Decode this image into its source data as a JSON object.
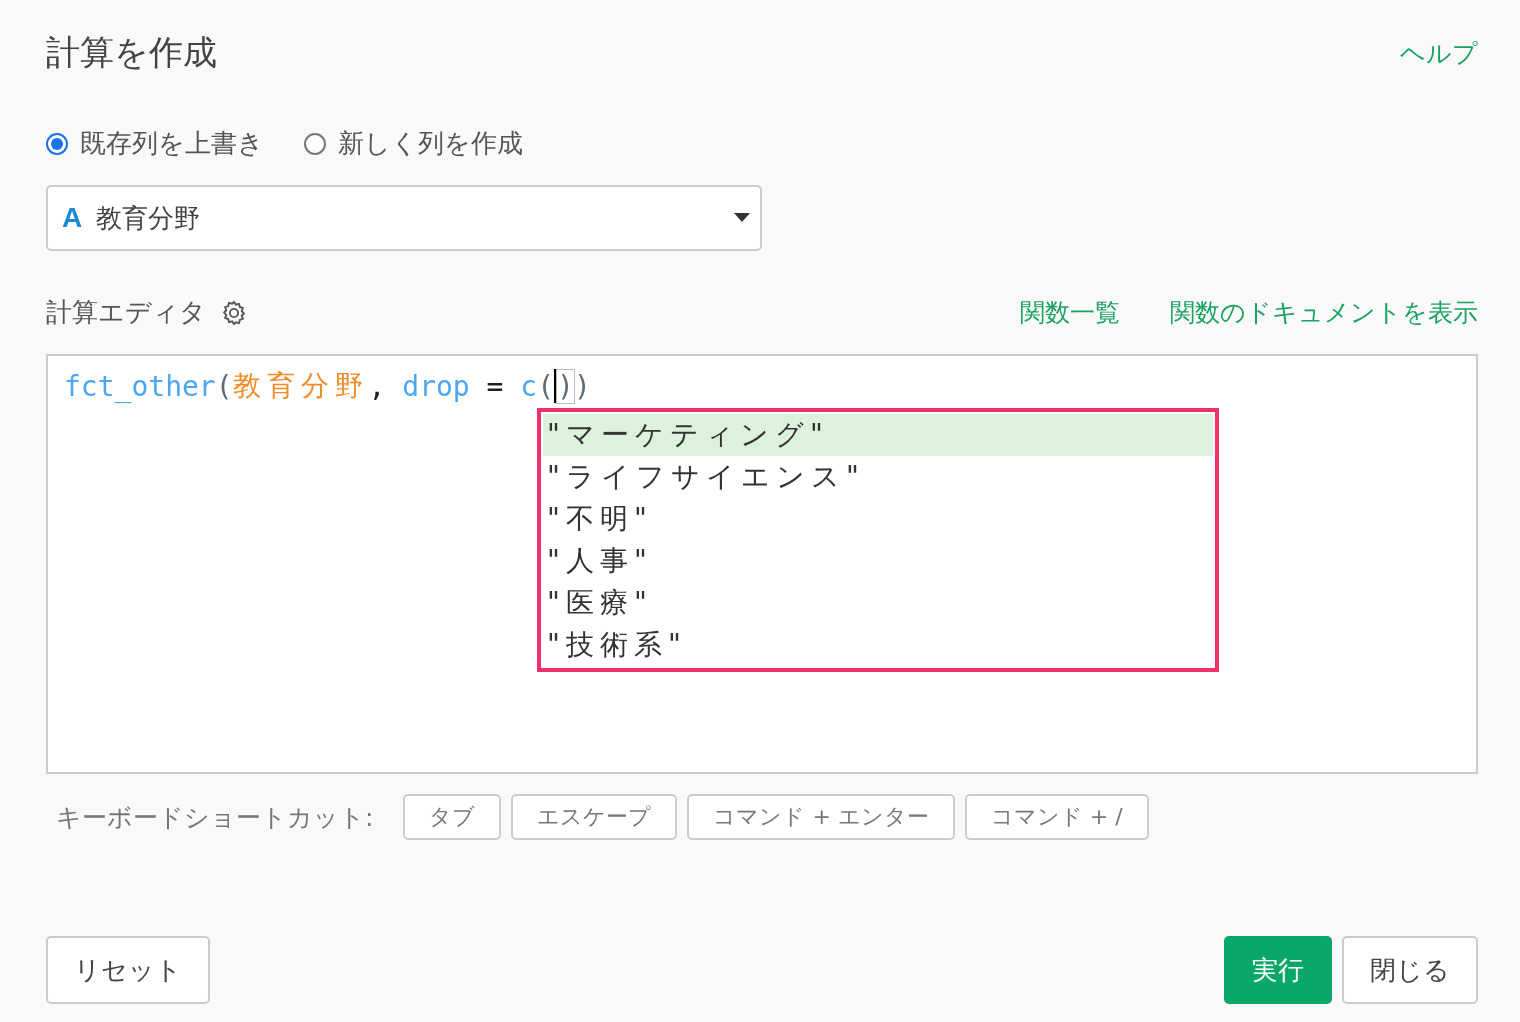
{
  "title": "計算を作成",
  "help_link": "ヘルプ",
  "mode_options": [
    {
      "label": "既存列を上書き",
      "selected": true
    },
    {
      "label": "新しく列を作成",
      "selected": false
    }
  ],
  "column_select": {
    "type_glyph": "A",
    "value": "教育分野"
  },
  "editor": {
    "label": "計算エディタ",
    "links": [
      "関数一覧",
      "関数のドキュメントを表示"
    ],
    "code": [
      {
        "kind": "name",
        "text": "fct_other"
      },
      {
        "kind": "paren",
        "text": "("
      },
      {
        "kind": "column",
        "text": "教育分野"
      },
      {
        "kind": "punct",
        "text": ", "
      },
      {
        "kind": "name",
        "text": "drop"
      },
      {
        "kind": "punct",
        "text": " = "
      },
      {
        "kind": "name",
        "text": "c"
      },
      {
        "kind": "paren",
        "text": "("
      },
      {
        "kind": "cursor"
      },
      {
        "kind": "match",
        "text": ")"
      },
      {
        "kind": "paren",
        "text": ")"
      }
    ],
    "suggestions": [
      {
        "text": "\"マーケティング\"",
        "selected": true
      },
      {
        "text": "\"ライフサイエンス\"",
        "selected": false
      },
      {
        "text": "\"不明\"",
        "selected": false
      },
      {
        "text": "\"人事\"",
        "selected": false
      },
      {
        "text": "\"医療\"",
        "selected": false
      },
      {
        "text": "\"技術系\"",
        "selected": false
      }
    ]
  },
  "shortcuts": {
    "label": "キーボードショートカット:",
    "keys": [
      "タブ",
      "エスケープ",
      "コマンド + エンター",
      "コマンド + /"
    ]
  },
  "footer": {
    "reset": "リセット",
    "run": "実行",
    "close": "閉じる"
  }
}
